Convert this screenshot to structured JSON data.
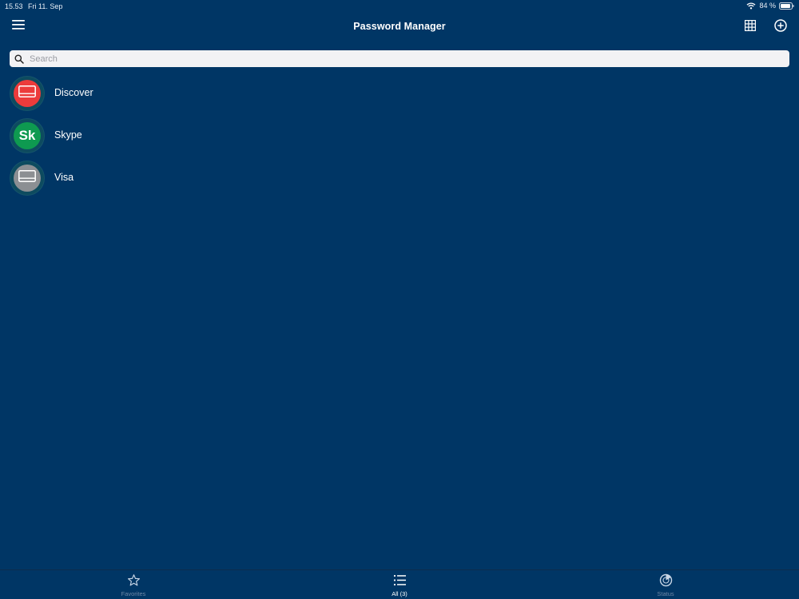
{
  "status_bar": {
    "time": "15.53",
    "date": "Fri 11. Sep",
    "battery": "84 %"
  },
  "nav": {
    "title": "Password Manager"
  },
  "search": {
    "placeholder": "Search",
    "value": ""
  },
  "items": [
    {
      "label": "Discover",
      "icon": "card-icon",
      "color": "#ec3b3b"
    },
    {
      "label": "Skype",
      "initials": "Sk",
      "color": "#0e9a50"
    },
    {
      "label": "Visa",
      "icon": "card-icon",
      "color": "#8c8f93"
    }
  ],
  "tabs": [
    {
      "label": "Favorites",
      "icon": "star-icon"
    },
    {
      "label": "All (3)",
      "icon": "list-icon"
    },
    {
      "label": "Status",
      "icon": "radar-icon"
    }
  ],
  "colors": {
    "background": "#003665",
    "tab_inactive": "#6f88a7"
  }
}
